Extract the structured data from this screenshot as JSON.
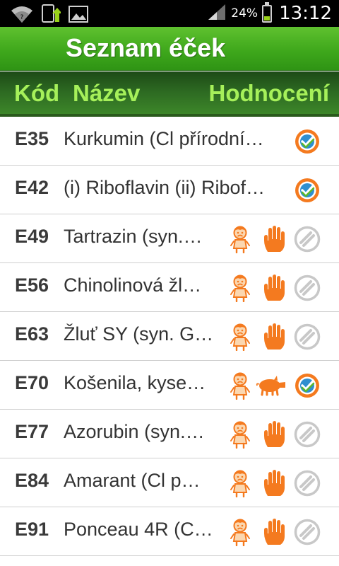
{
  "status_bar": {
    "battery_percent": "24%",
    "battery_level": 0.24,
    "time": "13:12",
    "left_icons": [
      "wifi-icon",
      "sync-icon",
      "image-icon"
    ],
    "right_icons": [
      "signal-icon",
      "battery-icon"
    ]
  },
  "title": "Seznam éček",
  "columns": {
    "code": "Kód",
    "name": "Název",
    "rating": "Hodnocení"
  },
  "colors": {
    "accent_green": "#3fa81c",
    "header_text": "#a6f05a",
    "warning_orange": "#f47a1f",
    "neutral_gray": "#c8c8c8"
  },
  "rows": [
    {
      "code": "E35",
      "name": "Kurkumin (Cl přírodní…",
      "icons": [
        "approved-icon"
      ]
    },
    {
      "code": "E42",
      "name": "(i) Riboflavin (ii) Ribof…",
      "icons": [
        "approved-icon"
      ]
    },
    {
      "code": "E49",
      "name": "Tartrazin (syn.…",
      "icons": [
        "sad-child-icon",
        "stop-hand-icon",
        "neutral-icon"
      ]
    },
    {
      "code": "E56",
      "name": "Chinolinová žl…",
      "icons": [
        "sad-child-icon",
        "stop-hand-icon",
        "neutral-icon"
      ]
    },
    {
      "code": "E63",
      "name": "Žluť SY (syn. G…",
      "icons": [
        "sad-child-icon",
        "stop-hand-icon",
        "neutral-icon"
      ]
    },
    {
      "code": "E70",
      "name": "Košenila, kyse…",
      "icons": [
        "sad-child-icon",
        "pig-icon",
        "approved-icon"
      ]
    },
    {
      "code": "E77",
      "name": "Azorubin (syn.…",
      "icons": [
        "sad-child-icon",
        "stop-hand-icon",
        "neutral-icon"
      ]
    },
    {
      "code": "E84",
      "name": "Amarant (Cl p…",
      "icons": [
        "sad-child-icon",
        "stop-hand-icon",
        "neutral-icon"
      ]
    },
    {
      "code": "E91",
      "name": "Ponceau 4R (C…",
      "icons": [
        "sad-child-icon",
        "stop-hand-icon",
        "neutral-icon"
      ]
    }
  ]
}
